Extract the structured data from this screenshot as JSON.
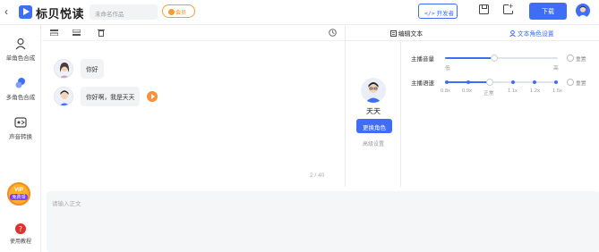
{
  "header": {
    "back_icon": "chevron-left-icon",
    "app_title": "标贝悦读",
    "work_name_placeholder": "未命名作品",
    "member_label": "会员",
    "developer_label": "开发者",
    "download_label": "下载"
  },
  "sidebar": {
    "items": [
      {
        "label": "单角色合成",
        "icon": "single-role-icon"
      },
      {
        "label": "多角色合成",
        "icon": "multi-role-icon"
      },
      {
        "label": "声音转换",
        "icon": "voice-convert-icon"
      }
    ],
    "vip_badge": "VIP",
    "vip_label": "免费领",
    "help_label": "使用教程"
  },
  "editor": {
    "messages": [
      {
        "text": "你好"
      },
      {
        "text": "你好啊，我是天天"
      }
    ],
    "count": "2 / 40",
    "input_placeholder": "请输入正文"
  },
  "panel": {
    "tabs": {
      "edit_text": "编辑文本",
      "role_setting": "文本角色设置"
    },
    "role_name": "天天",
    "change_role": "更换角色",
    "advanced": "高级设置",
    "volume": {
      "label": "主播音量",
      "low": "低",
      "high": "高",
      "value_fraction": 0.44,
      "reset": "重置"
    },
    "speed": {
      "label": "主播语速",
      "ticks": [
        "0.8x",
        "0.9x",
        "正常",
        "1.1x",
        "1.2x",
        "1.5x"
      ],
      "selected": "正常",
      "reset": "重置"
    }
  },
  "colors": {
    "accent": "#3f6df6",
    "orange": "#f7913b"
  }
}
